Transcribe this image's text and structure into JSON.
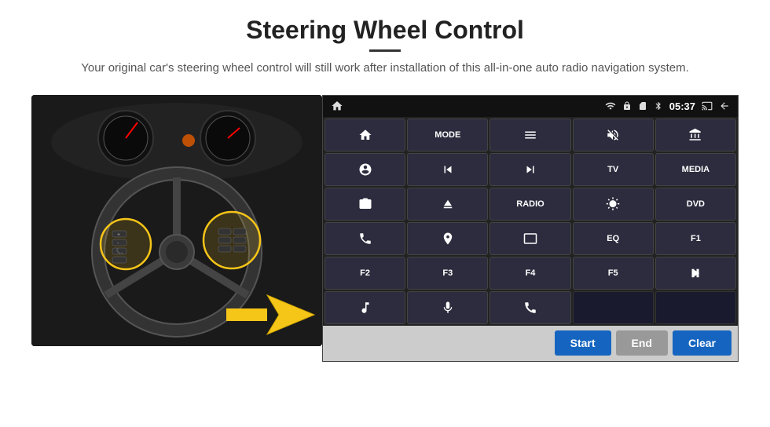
{
  "header": {
    "title": "Steering Wheel Control",
    "divider": true,
    "subtitle": "Your original car's steering wheel control will still work after installation of this all-in-one auto radio navigation system."
  },
  "status_bar": {
    "time": "05:37",
    "icons": [
      "wifi",
      "lock",
      "sim",
      "bluetooth",
      "cast",
      "back"
    ]
  },
  "button_grid": [
    {
      "id": "r1c1",
      "type": "icon",
      "label": "home"
    },
    {
      "id": "r1c2",
      "type": "text",
      "label": "MODE"
    },
    {
      "id": "r1c3",
      "type": "icon",
      "label": "menu-list"
    },
    {
      "id": "r1c4",
      "type": "icon",
      "label": "mute"
    },
    {
      "id": "r1c5",
      "type": "icon",
      "label": "apps"
    },
    {
      "id": "r2c1",
      "type": "icon",
      "label": "settings-circle"
    },
    {
      "id": "r2c2",
      "type": "icon",
      "label": "prev"
    },
    {
      "id": "r2c3",
      "type": "icon",
      "label": "next"
    },
    {
      "id": "r2c4",
      "type": "text",
      "label": "TV"
    },
    {
      "id": "r2c5",
      "type": "text",
      "label": "MEDIA"
    },
    {
      "id": "r3c1",
      "type": "icon",
      "label": "360-cam"
    },
    {
      "id": "r3c2",
      "type": "icon",
      "label": "eject"
    },
    {
      "id": "r3c3",
      "type": "text",
      "label": "RADIO"
    },
    {
      "id": "r3c4",
      "type": "icon",
      "label": "brightness"
    },
    {
      "id": "r3c5",
      "type": "text",
      "label": "DVD"
    },
    {
      "id": "r4c1",
      "type": "icon",
      "label": "phone"
    },
    {
      "id": "r4c2",
      "type": "icon",
      "label": "navigation"
    },
    {
      "id": "r4c3",
      "type": "icon",
      "label": "screen"
    },
    {
      "id": "r4c4",
      "type": "text",
      "label": "EQ"
    },
    {
      "id": "r4c5",
      "type": "text",
      "label": "F1"
    },
    {
      "id": "r5c1",
      "type": "text",
      "label": "F2"
    },
    {
      "id": "r5c2",
      "type": "text",
      "label": "F3"
    },
    {
      "id": "r5c3",
      "type": "text",
      "label": "F4"
    },
    {
      "id": "r5c4",
      "type": "text",
      "label": "F5"
    },
    {
      "id": "r5c5",
      "type": "icon",
      "label": "play-pause"
    },
    {
      "id": "r6c1",
      "type": "icon",
      "label": "music"
    },
    {
      "id": "r6c2",
      "type": "icon",
      "label": "microphone"
    },
    {
      "id": "r6c3",
      "type": "icon",
      "label": "phone-end"
    },
    {
      "id": "r6c4",
      "type": "empty",
      "label": ""
    },
    {
      "id": "r6c5",
      "type": "empty",
      "label": ""
    }
  ],
  "action_bar": {
    "start_label": "Start",
    "end_label": "End",
    "clear_label": "Clear"
  }
}
